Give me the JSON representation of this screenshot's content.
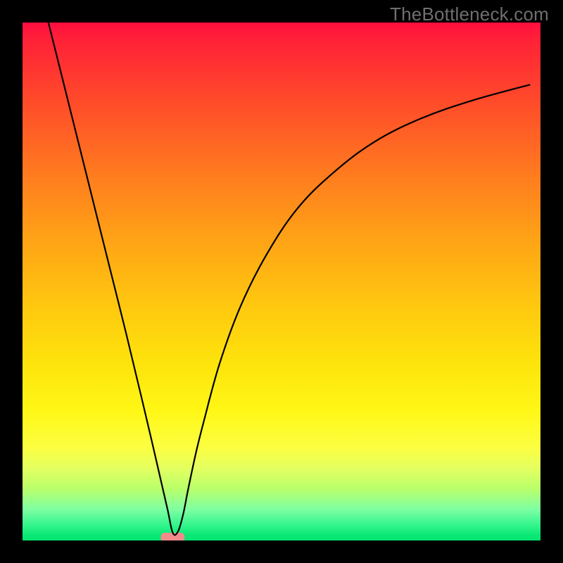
{
  "watermark": "TheBottleneck.com",
  "chart_data": {
    "type": "line",
    "title": "",
    "xlabel": "",
    "ylabel": "",
    "xlim": [
      0,
      100
    ],
    "ylim": [
      0,
      100
    ],
    "grid": false,
    "legend": false,
    "annotations": [],
    "notch": {
      "x": 29,
      "width": 3,
      "color": "#f28b8b"
    },
    "background_gradient": {
      "0": "#ff0e3f",
      "50": "#ffbe10",
      "80": "#fbff3c",
      "100": "#02e571"
    },
    "series": [
      {
        "name": "bottleneck-curve",
        "type": "line",
        "color": "#000000",
        "x": [
          5.0,
          8.0,
          11.0,
          14.0,
          17.0,
          20.0,
          23.0,
          25.0,
          26.5,
          28.0,
          29.0,
          30.0,
          31.0,
          32.0,
          33.5,
          35.0,
          38.0,
          42.0,
          47.0,
          53.0,
          60.0,
          68.0,
          77.0,
          87.0,
          98.0
        ],
        "values": [
          100,
          88.0,
          76.0,
          64.0,
          52.0,
          40.0,
          27.5,
          19.0,
          12.5,
          6.0,
          1.5,
          1.7,
          5.0,
          10.0,
          17.0,
          23.0,
          34.0,
          45.0,
          55.0,
          64.0,
          71.0,
          77.0,
          81.5,
          85.0,
          88.0
        ]
      }
    ]
  }
}
